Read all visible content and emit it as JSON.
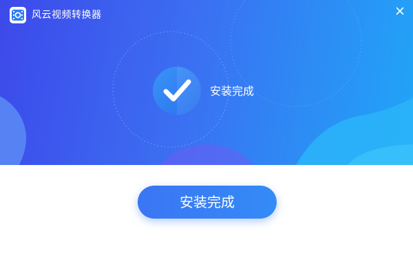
{
  "window": {
    "title": "风云视频转换器",
    "logo_icon": "video-converter-logo-icon",
    "close_icon": "close-icon"
  },
  "status": {
    "icon": "check-icon",
    "message": "安装完成"
  },
  "actions": {
    "finish_label": "安装完成"
  },
  "colors": {
    "banner_start": "#3d49ea",
    "banner_end": "#20a6f7",
    "button": "#3b7ff4",
    "check_circle": "#2f86f5"
  }
}
